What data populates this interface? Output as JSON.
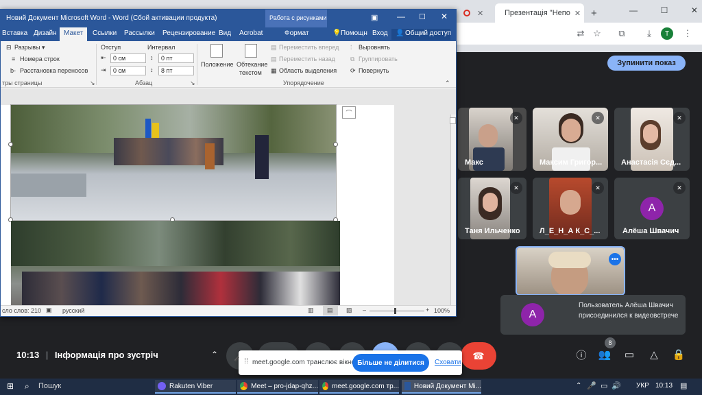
{
  "browser": {
    "tabs": [
      {
        "label": "Презентація \"Непо"
      }
    ],
    "new_tab": "+",
    "window_controls": [
      "—",
      "☐",
      "✕"
    ],
    "profile_initial": "T"
  },
  "meet": {
    "stop_presenting": "Зупинити показ",
    "participants": [
      {
        "name": "Макс"
      },
      {
        "name": "Максим Григор..."
      },
      {
        "name": "Анастасія Сєд..."
      },
      {
        "name": "Таня Ильченко"
      },
      {
        "name": "Л_Е_Н_А К_С_..."
      },
      {
        "name": "Алёша Швачич",
        "initial": "А"
      }
    ],
    "notification": {
      "initial": "А",
      "text": "Пользователь Алёша Швачич присоединился к видеовстрече"
    },
    "time": "10:13",
    "separator": "|",
    "meeting_details": "Інформація про зустріч",
    "people_count": "8",
    "colors": {
      "accent": "#8ab4f8",
      "end_call": "#ea4335",
      "avatar": "#8e24aa"
    }
  },
  "word": {
    "title": "Новий Документ Microsoft Word - Word (Сбой активации продукта)",
    "context_tab": "Работа с рисунками",
    "menu": [
      "Вставка",
      "Дизайн",
      "Макет",
      "Ссылки",
      "Рассылки",
      "Рецензирование",
      "Вид",
      "Acrobat",
      "Формат"
    ],
    "help": "Помощн",
    "signin": "Вход",
    "share": "Общий доступ",
    "ribbon": {
      "breaks": "Разрывы",
      "line_numbers": "Номера строк",
      "hyphenation": "Расстановка переносов",
      "page_setup": "тры страницы",
      "indent_label": "Отступ",
      "spacing_label": "Интервал",
      "indent_left": "0 см",
      "indent_right": "0 см",
      "spacing_before": "0 пт",
      "spacing_after": "8 пт",
      "paragraph_group": "Абзац",
      "position": "Положение",
      "wrap_text_1": "Обтекание",
      "wrap_text_2": "текстом",
      "bring_forward": "Переместить вперед",
      "send_backward": "Переместить назад",
      "selection_pane": "Область выделения",
      "align": "Выровнять",
      "group": "Группировать",
      "rotate": "Повернуть",
      "arrange_group": "Упорядочение"
    },
    "status": {
      "words": "сло слов: 210",
      "language": "русский",
      "zoom": "100%",
      "zoom_minus": "–",
      "zoom_plus": "+"
    }
  },
  "sharebar": {
    "text": "meet.google.com транслює вікно.",
    "stop": "Більше не ділитися",
    "hide": "Сховати"
  },
  "taskbar": {
    "search": "Пошук",
    "apps": [
      {
        "label": "Rakuten Viber"
      },
      {
        "label": "Meet – pro-jdap-qhz..."
      },
      {
        "label": "meet.google.com тр..."
      },
      {
        "label": "Новий Документ Mi..."
      }
    ],
    "lang": "УКР",
    "time": "10:13"
  }
}
